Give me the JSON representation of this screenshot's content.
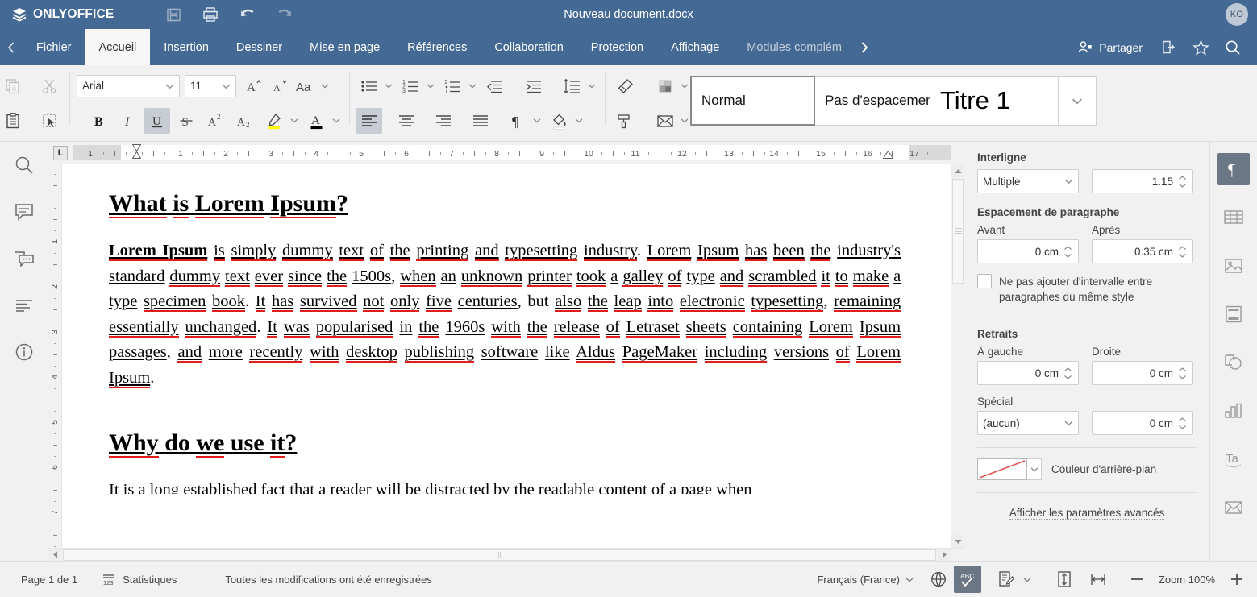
{
  "titlebar": {
    "brand": "ONLYOFFICE",
    "document_title": "Nouveau document.docx",
    "avatar_initials": "KO",
    "quick_icons": [
      {
        "name": "save-icon",
        "label": "Enregistrer"
      },
      {
        "name": "print-icon",
        "label": "Imprimer"
      },
      {
        "name": "undo-icon",
        "label": "Annuler"
      },
      {
        "name": "redo-icon",
        "label": "Rétablir"
      }
    ]
  },
  "tabbar": {
    "tabs": [
      {
        "label": "Fichier",
        "active": false
      },
      {
        "label": "Accueil",
        "active": true
      },
      {
        "label": "Insertion",
        "active": false
      },
      {
        "label": "Dessiner",
        "active": false
      },
      {
        "label": "Mise en page",
        "active": false
      },
      {
        "label": "Références",
        "active": false
      },
      {
        "label": "Collaboration",
        "active": false
      },
      {
        "label": "Protection",
        "active": false
      },
      {
        "label": "Affichage",
        "active": false
      },
      {
        "label": "Modules complém",
        "active": false
      }
    ],
    "share_label": "Partager"
  },
  "ribbon": {
    "font_name": "Arial",
    "font_size": "11",
    "styles": [
      {
        "label": "Normal",
        "selected": true
      },
      {
        "label": "Pas d'espacement",
        "selected": false
      },
      {
        "label": "Titre 1",
        "selected": false
      }
    ]
  },
  "ruler": {
    "corner_label": "L",
    "h_ticks": [
      "1",
      "1",
      "2",
      "3",
      "4",
      "5",
      "6",
      "7",
      "8",
      "9",
      "10",
      "11",
      "12",
      "13",
      "14",
      "15",
      "16",
      "17"
    ],
    "v_ticks": [
      "1",
      "2",
      "3",
      "4",
      "5",
      "6",
      "7"
    ]
  },
  "document": {
    "heading1": "What is Lorem Ipsum?",
    "para1_lead": "Lorem Ipsum",
    "para1": " is simply dummy text of the printing and typesetting industry. Lorem Ipsum has been the industry's standard dummy text ever since the 1500s, when an unknown printer took a galley of type and scrambled it to make a type specimen book. It has survived not only five centuries, but also the leap into electronic typesetting, remaining essentially unchanged. It was popularised in the 1960s with the release of Letraset sheets containing Lorem Ipsum passages, and more recently with desktop publishing software like Aldus PageMaker including versions of Lorem Ipsum.",
    "heading2": "Why do we use it?",
    "para2_clipped": "It is a long established fact that a reader will be distracted by the readable content of a page when"
  },
  "rightpanel": {
    "line_spacing_title": "Interligne",
    "line_spacing_mode": "Multiple",
    "line_spacing_value": "1.15",
    "paragraph_spacing_title": "Espacement de paragraphe",
    "before_label": "Avant",
    "before_value": "0 cm",
    "after_label": "Après",
    "after_value": "0.35 cm",
    "no_space_checkbox": "Ne pas ajouter d'intervalle entre paragraphes du même style",
    "indents_title": "Retraits",
    "left_label": "À gauche",
    "left_value": "0 cm",
    "right_label": "Droite",
    "right_value": "0 cm",
    "special_label": "Spécial",
    "special_value": "(aucun)",
    "special_amount": "0 cm",
    "background_color_label": "Couleur d'arrière-plan",
    "advanced_link": "Afficher les paramètres avancés"
  },
  "rightbar": {
    "icons": [
      {
        "name": "paragraph-settings-icon",
        "active": true
      },
      {
        "name": "table-settings-icon",
        "active": false
      },
      {
        "name": "image-settings-icon",
        "active": false
      },
      {
        "name": "header-footer-settings-icon",
        "active": false
      },
      {
        "name": "shape-settings-icon",
        "active": false
      },
      {
        "name": "chart-settings-icon",
        "active": false
      },
      {
        "name": "text-art-settings-icon",
        "active": false
      },
      {
        "name": "mail-merge-settings-icon",
        "active": false
      }
    ]
  },
  "leftbar": {
    "icons": [
      {
        "name": "search-icon"
      },
      {
        "name": "comments-icon"
      },
      {
        "name": "chat-icon"
      },
      {
        "name": "navigation-icon"
      },
      {
        "name": "about-icon"
      }
    ]
  },
  "statusbar": {
    "page_label": "Page 1 de 1",
    "stats_label": "Statistiques",
    "save_message": "Toutes les modifications ont été enregistrées",
    "language": "Français (France)",
    "zoom_label": "Zoom 100%"
  },
  "colors": {
    "header_blue": "#446995",
    "ribbon_bg": "#f1f1f1",
    "active_tab_bg": "#f7f7f7",
    "spellcheck_red": "#e21b1b",
    "accent_gray": "#6b7785",
    "highlight_yellow": "#ffff00"
  }
}
